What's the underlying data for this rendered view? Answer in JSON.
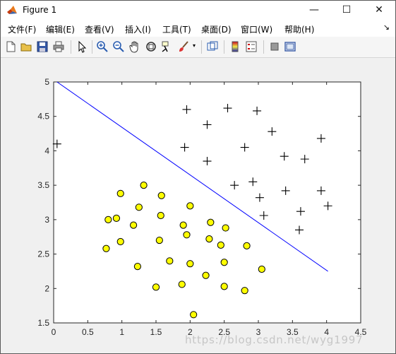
{
  "window": {
    "title": "Figure 1",
    "controls": [
      "—",
      "☐",
      "✕"
    ]
  },
  "menu": {
    "items": [
      "文件(F)",
      "编辑(E)",
      "查看(V)",
      "插入(I)",
      "工具(T)",
      "桌面(D)",
      "窗口(W)",
      "帮助(H)"
    ],
    "overflow": "↘"
  },
  "toolbar": {
    "icons": [
      "new-figure-icon",
      "open-file-icon",
      "save-icon",
      "print-icon",
      "pointer-icon",
      "zoom-in-icon",
      "zoom-out-icon",
      "pan-hand-icon",
      "rotate-3d-icon",
      "data-cursor-icon",
      "brush-icon",
      "link-plot-icon",
      "colorbar-icon",
      "legend-icon",
      "hide-plot-tools-icon",
      "show-plot-tools-icon"
    ]
  },
  "chart_data": {
    "type": "scatter",
    "title": "",
    "xlabel": "",
    "ylabel": "",
    "xlim": [
      0,
      4.5
    ],
    "ylim": [
      1.5,
      5
    ],
    "xticks": [
      "0",
      "0.5",
      "1",
      "1.5",
      "2",
      "2.5",
      "3",
      "3.5",
      "4",
      "4.5"
    ],
    "yticks": [
      "1.5",
      "2",
      "2.5",
      "3",
      "3.5",
      "4",
      "4.5",
      "5"
    ],
    "grid": false,
    "series": [
      {
        "marker": "plus",
        "color": "#000000",
        "points": [
          [
            0.05,
            4.1
          ],
          [
            1.95,
            4.6
          ],
          [
            2.55,
            4.62
          ],
          [
            2.98,
            4.58
          ],
          [
            2.25,
            4.38
          ],
          [
            3.2,
            4.28
          ],
          [
            3.92,
            4.18
          ],
          [
            1.92,
            4.05
          ],
          [
            2.8,
            4.05
          ],
          [
            3.38,
            3.92
          ],
          [
            2.25,
            3.85
          ],
          [
            3.68,
            3.88
          ],
          [
            2.65,
            3.5
          ],
          [
            2.92,
            3.55
          ],
          [
            3.4,
            3.42
          ],
          [
            3.92,
            3.42
          ],
          [
            3.02,
            3.32
          ],
          [
            4.02,
            3.2
          ],
          [
            3.62,
            3.12
          ],
          [
            3.08,
            3.06
          ],
          [
            3.6,
            2.85
          ]
        ]
      },
      {
        "marker": "circle",
        "color": "#ffff00",
        "edge": "#000000",
        "points": [
          [
            0.98,
            3.38
          ],
          [
            1.32,
            3.5
          ],
          [
            1.58,
            3.35
          ],
          [
            1.25,
            3.18
          ],
          [
            2.0,
            3.2
          ],
          [
            0.8,
            3.0
          ],
          [
            0.92,
            3.02
          ],
          [
            1.57,
            3.06
          ],
          [
            1.17,
            2.92
          ],
          [
            1.9,
            2.92
          ],
          [
            2.3,
            2.96
          ],
          [
            2.52,
            2.88
          ],
          [
            1.95,
            2.78
          ],
          [
            0.98,
            2.68
          ],
          [
            1.55,
            2.7
          ],
          [
            2.28,
            2.72
          ],
          [
            2.45,
            2.63
          ],
          [
            2.83,
            2.62
          ],
          [
            0.77,
            2.58
          ],
          [
            1.7,
            2.4
          ],
          [
            2.0,
            2.36
          ],
          [
            2.5,
            2.38
          ],
          [
            1.23,
            2.32
          ],
          [
            3.05,
            2.28
          ],
          [
            2.23,
            2.19
          ],
          [
            1.88,
            2.06
          ],
          [
            1.5,
            2.02
          ],
          [
            2.5,
            2.03
          ],
          [
            2.8,
            1.97
          ],
          [
            2.05,
            1.62
          ]
        ]
      },
      {
        "type": "line",
        "color": "#0000ff",
        "points": [
          [
            0.05,
            5.0
          ],
          [
            4.02,
            2.25
          ]
        ]
      }
    ]
  },
  "watermark": "https://blog.csdn.net/wyg1997"
}
